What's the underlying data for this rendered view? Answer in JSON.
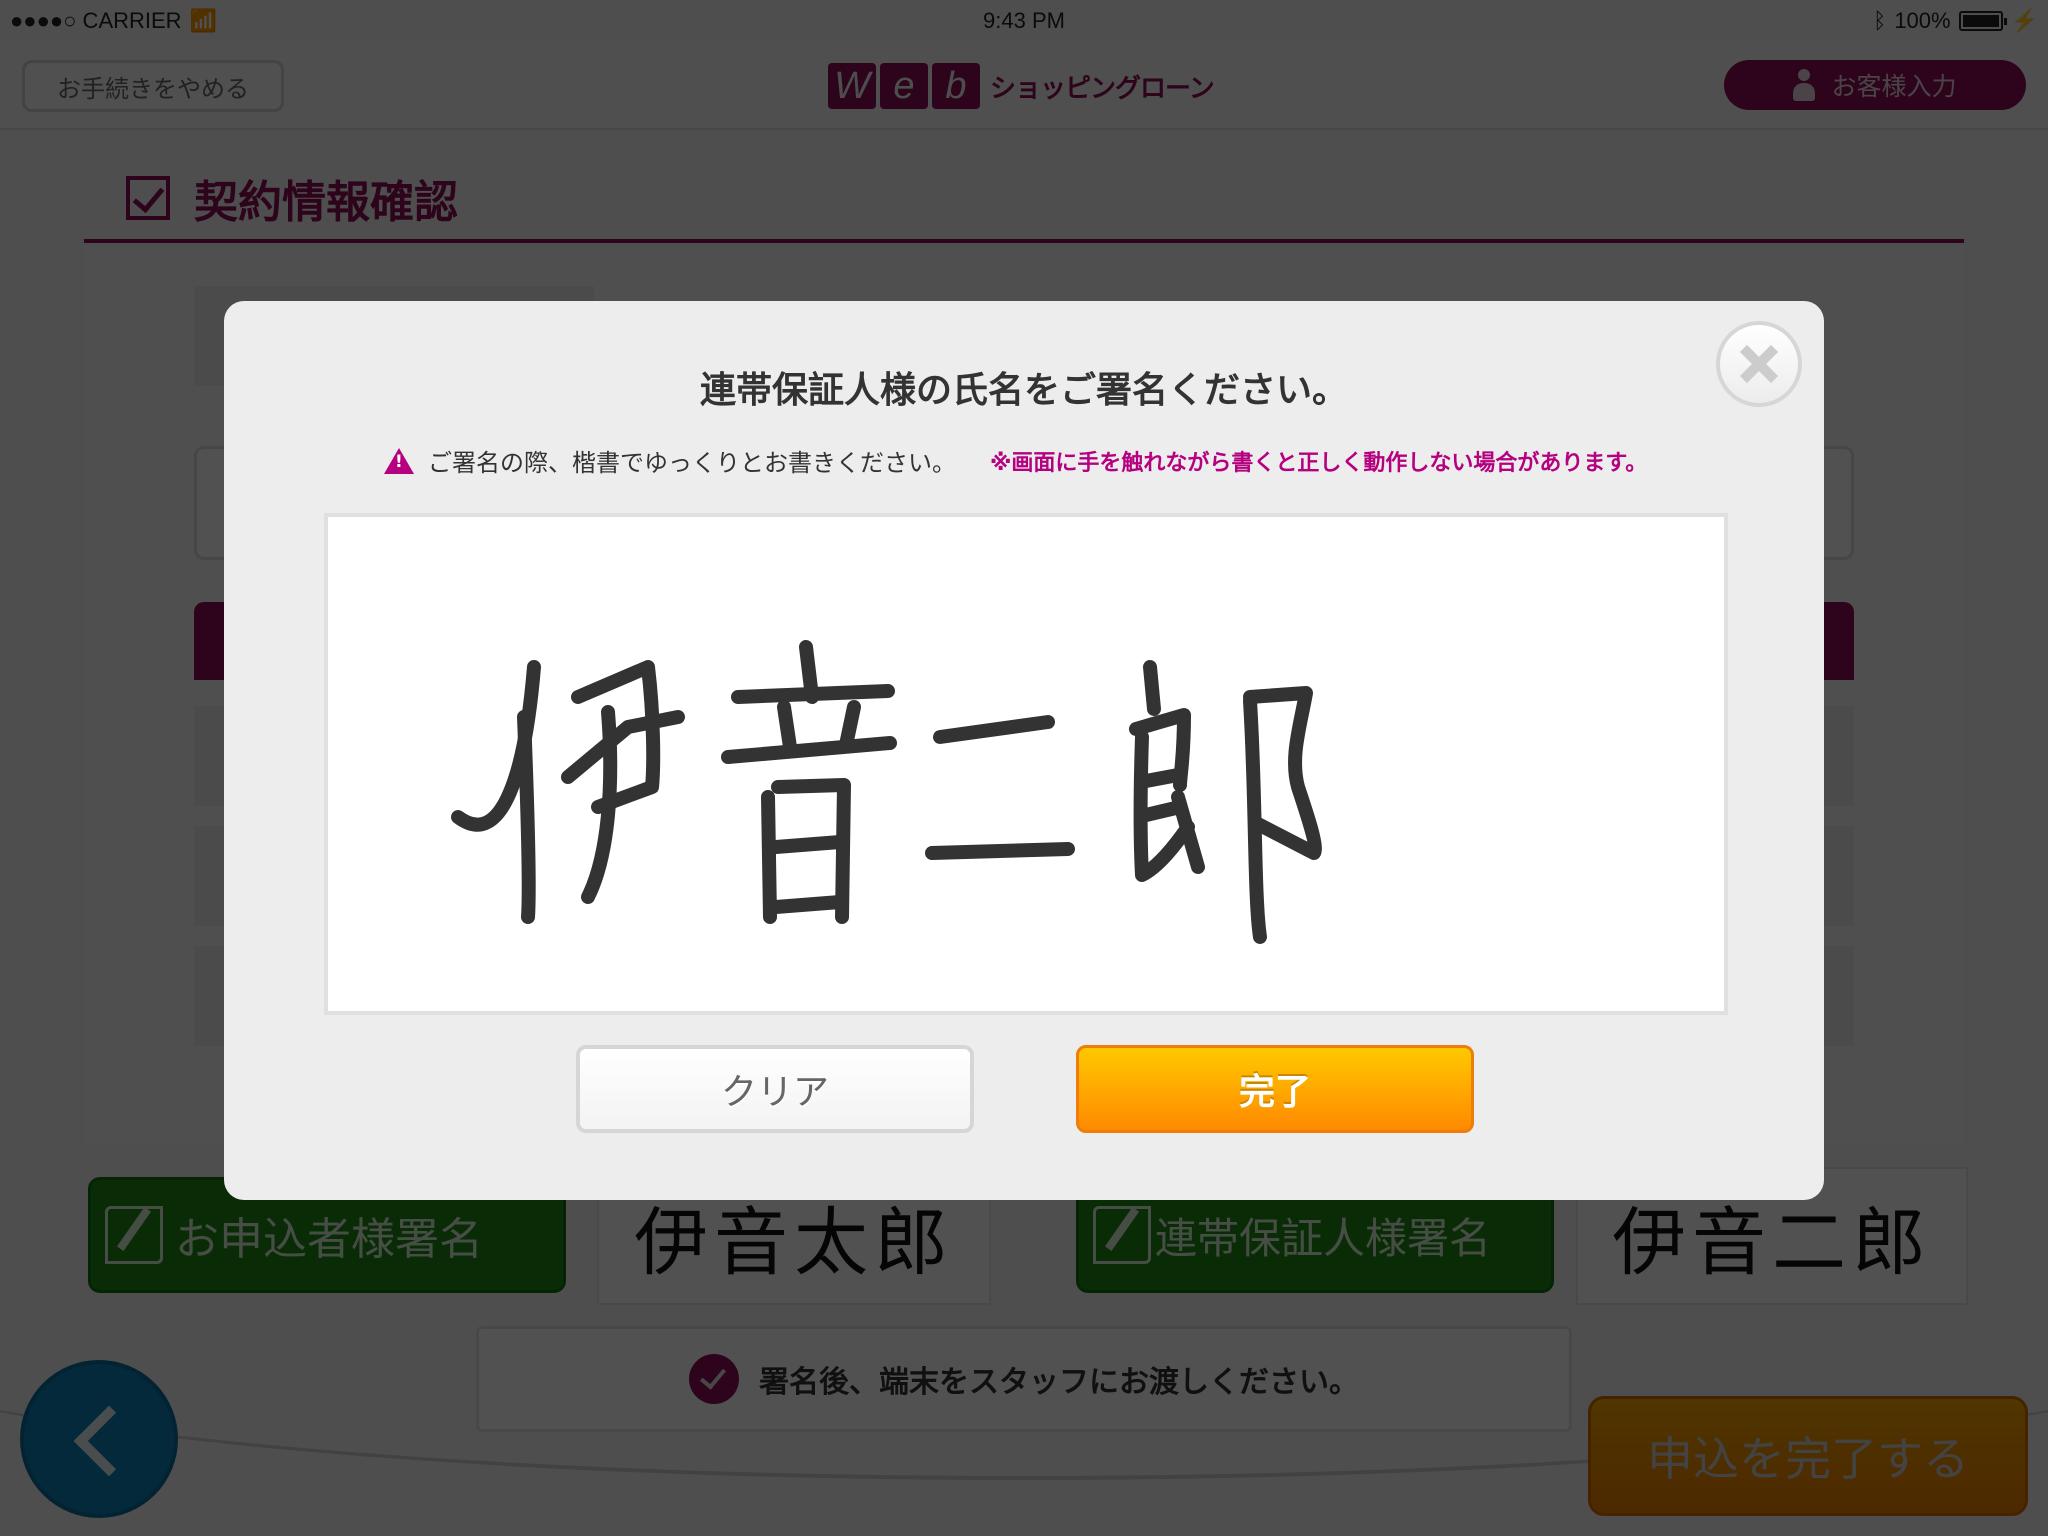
{
  "status_bar": {
    "carrier": "●●●●○ CARRIER",
    "time": "9:43 PM",
    "battery_percent": "100%",
    "battery_level": 1.0
  },
  "navbar": {
    "cancel_label": "お手続きをやめる",
    "logo_letters": [
      "W",
      "e",
      "b"
    ],
    "logo_text": "ショッピングローン",
    "customer_input_label": "お客様入力"
  },
  "page": {
    "title": "契約情報確認"
  },
  "signature_section": {
    "applicant_button_label": "お申込者様署名",
    "applicant_signature": "伊音太郎",
    "guarantor_button_label": "連帯保証人様署名",
    "guarantor_signature": "伊音二郎",
    "notice_text": "署名後、端末をスタッフにお渡しください。",
    "submit_label": "申込を完了する"
  },
  "modal": {
    "title": "連帯保証人様の氏名をご署名ください。",
    "warning_text": "ご署名の際、楷書でゆっくりとお書きください。",
    "warning_note": "※画面に手を触れながら書くと正しく動作しない場合があります。",
    "signed_name": "伊音二郎",
    "clear_label": "クリア",
    "done_label": "完了"
  },
  "colors": {
    "brand": "#8b0f56",
    "warning_accent": "#b5007f",
    "done_button": "#ffa500",
    "signature_button": "#1d8a16",
    "back_button": "#0a7fb6"
  }
}
